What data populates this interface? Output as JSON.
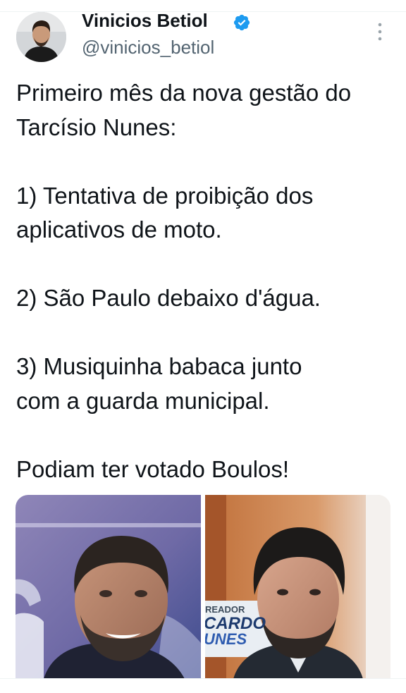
{
  "author": {
    "name": "Vinicios Betiol",
    "handle": "@vinicios_betiol"
  },
  "tweet": {
    "lines": [
      "Primeiro mês da nova gestão do",
      "Tarcísio Nunes:",
      "1) Tentativa de proibição dos",
      "aplicativos de moto.",
      "2) São Paulo debaixo d'água.",
      "3) Musiquinha babaca junto",
      "com a guarda municipal.",
      "Podiam ter votado Boulos!"
    ]
  },
  "media": {
    "right_photo_backdrop_text": [
      "READOR",
      "CARDO",
      "UNES"
    ]
  },
  "colors": {
    "verified": "#1d9bf0",
    "handle": "#536471",
    "text": "#0f1419"
  },
  "icons": [
    "verified-badge-icon",
    "more-options-icon"
  ]
}
